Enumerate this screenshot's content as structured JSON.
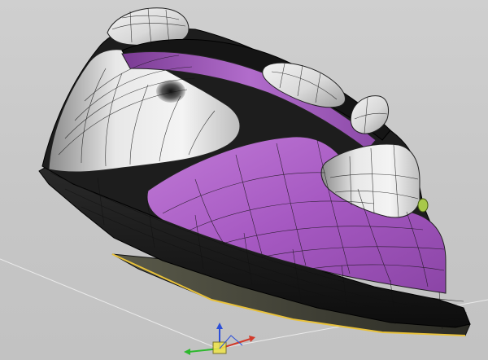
{
  "viewport": {
    "colors": {
      "background": "#c6c6c6",
      "body_shell": "#1c1c1c",
      "chrome_white": "#e6e6e6",
      "purple_panel": "#a55ec0",
      "soleplate": "#3a3a30",
      "soleplate_edge": "#e8c13a",
      "wireframe": "#111111"
    },
    "gizmo": {
      "axes": [
        "x-axis",
        "y-axis",
        "z-axis"
      ],
      "colors": {
        "x": "#d23a2a",
        "y": "#2db82d",
        "z": "#2c4fd8",
        "pivot": "#f0e64a"
      }
    }
  }
}
